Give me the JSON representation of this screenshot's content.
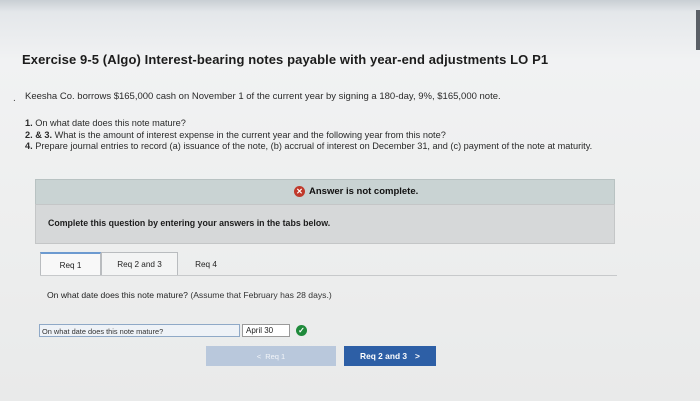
{
  "exercise": {
    "title": "Exercise 9-5 (Algo) Interest-bearing notes payable with year-end adjustments LO P1",
    "bullet": ".",
    "intro": "Keesha Co. borrows $165,000 cash on November 1 of the current year by signing a 180-day, 9%, $165,000 note.",
    "questions": [
      {
        "num": "1.",
        "text": " On what date does this note mature?"
      },
      {
        "num": "2. & 3.",
        "text": " What is the amount of interest expense in the current year and the following year from this note?"
      },
      {
        "num": "4.",
        "text": " Prepare journal entries to record (a) issuance of the note, (b) accrual of interest on December 31, and (c) payment of the note at maturity."
      }
    ]
  },
  "notice": {
    "icon": "x-circle-icon",
    "text": "Answer is not complete."
  },
  "instructions": "Complete this question by entering your answers in the tabs below.",
  "tabs": [
    {
      "label": "Req 1"
    },
    {
      "label": "Req 2 and 3"
    },
    {
      "label": "Req 4"
    }
  ],
  "panel": {
    "question": "On what date does this note mature?",
    "assumption": "(Assume that February has 28 days.)",
    "answer_label": "On what date does this note mature?",
    "answer_value": "April 30"
  },
  "nav": {
    "prev_label": "Req 1",
    "next_label": "Req 2 and 3",
    "next_arrow": ">",
    "prev_arrow": "<"
  },
  "colors": {
    "accent": "#2d5fa6",
    "error": "#c0392b",
    "success": "#1f8a3b"
  }
}
